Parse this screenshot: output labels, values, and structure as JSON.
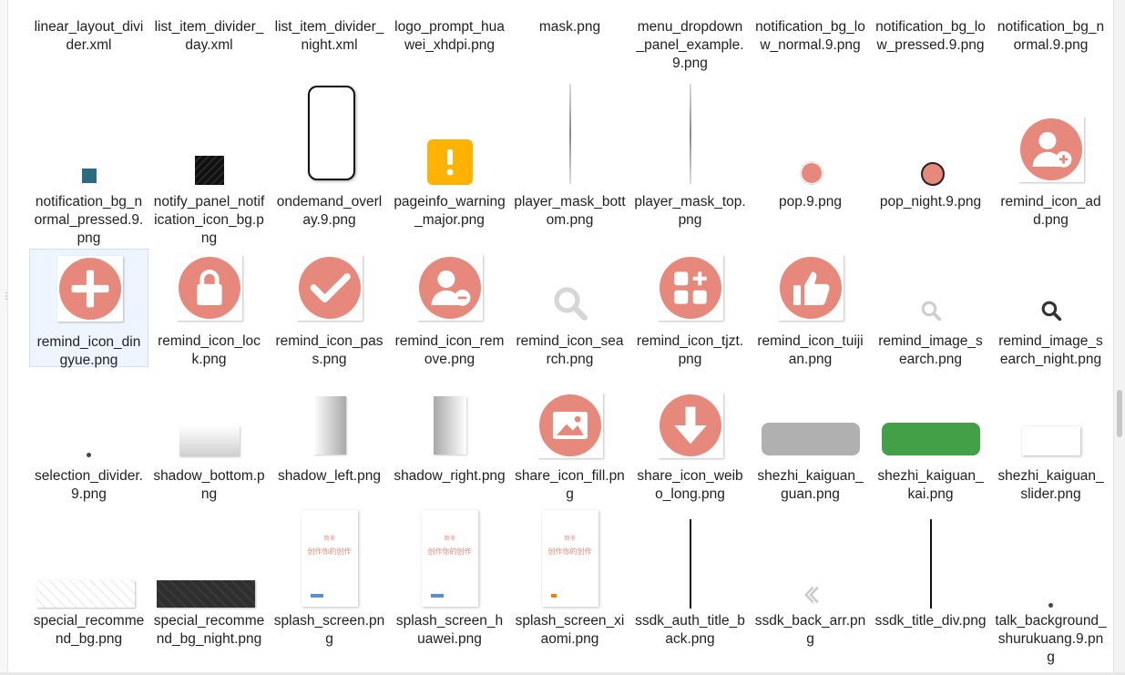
{
  "colors": {
    "accent_icon": "#e6897c",
    "selection_bg": "#eef5ff",
    "teal_square": "#2e6a80",
    "green_switch": "#43a047",
    "gray_switch": "#b0b0b0",
    "warning": "#ffb300"
  },
  "splash": {
    "title_small": "简书",
    "tagline": "创作你的创作"
  },
  "files": [
    {
      "name": "linear_layout_divider.xml",
      "thumb": "topframe"
    },
    {
      "name": "list_item_divider_day.xml",
      "thumb": "topframe"
    },
    {
      "name": "list_item_divider_night.xml",
      "thumb": "topframe"
    },
    {
      "name": "logo_prompt_huawei_xhdpi.png",
      "thumb": "topframe-accent"
    },
    {
      "name": "mask.png",
      "thumb": "dot-top"
    },
    {
      "name": "menu_dropdown_panel_example.9.png",
      "thumb": "topframe"
    },
    {
      "name": "notification_bg_low_normal.9.png",
      "thumb": "topstub-dark"
    },
    {
      "name": "notification_bg_low_pressed.9.png",
      "thumb": "topstub-teal"
    },
    {
      "name": "notification_bg_normal.9.png",
      "thumb": "topstub-dark"
    },
    {
      "name": "notification_bg_normal_pressed.9.png",
      "thumb": "teal-square"
    },
    {
      "name": "notify_panel_notification_icon_bg.png",
      "thumb": "black-square"
    },
    {
      "name": "ondemand_overlay.9.png",
      "thumb": "phone-frame"
    },
    {
      "name": "pageinfo_warning_major.png",
      "thumb": "warning"
    },
    {
      "name": "player_mask_bottom.png",
      "thumb": "vline"
    },
    {
      "name": "player_mask_top.png",
      "thumb": "vline"
    },
    {
      "name": "pop.9.png",
      "thumb": "pop"
    },
    {
      "name": "pop_night.9.png",
      "thumb": "pop-night"
    },
    {
      "name": "remind_icon_add.png",
      "thumb": "circle-user-add"
    },
    {
      "name": "remind_icon_dingyue.png",
      "thumb": "circle-plus",
      "selected": true
    },
    {
      "name": "remind_icon_lock.png",
      "thumb": "circle-lock"
    },
    {
      "name": "remind_icon_pass.png",
      "thumb": "circle-check"
    },
    {
      "name": "remind_icon_remove.png",
      "thumb": "circle-user-remove"
    },
    {
      "name": "remind_icon_search.png",
      "thumb": "search-light"
    },
    {
      "name": "remind_icon_tjzt.png",
      "thumb": "circle-grid"
    },
    {
      "name": "remind_icon_tuijian.png",
      "thumb": "circle-thumb"
    },
    {
      "name": "remind_image_search.png",
      "thumb": "search-small-light"
    },
    {
      "name": "remind_image_search_night.png",
      "thumb": "search-small-dark"
    },
    {
      "name": "selection_divider.9.png",
      "thumb": "tiny-dot"
    },
    {
      "name": "shadow_bottom.png",
      "thumb": "shadow-bottom"
    },
    {
      "name": "shadow_left.png",
      "thumb": "shadow-left"
    },
    {
      "name": "shadow_right.png",
      "thumb": "shadow-right"
    },
    {
      "name": "share_icon_fill.png",
      "thumb": "circle-image"
    },
    {
      "name": "share_icon_weibo_long.png",
      "thumb": "circle-arrow"
    },
    {
      "name": "shezhi_kaiguan_guan.png",
      "thumb": "switch-gray"
    },
    {
      "name": "shezhi_kaiguan_kai.png",
      "thumb": "switch-green"
    },
    {
      "name": "shezhi_kaiguan_slider.png",
      "thumb": "switch-white"
    },
    {
      "name": "special_recommend_bg.png",
      "thumb": "pattern-light"
    },
    {
      "name": "special_recommend_bg_night.png",
      "thumb": "pattern-dark"
    },
    {
      "name": "splash_screen.png",
      "thumb": "splash"
    },
    {
      "name": "splash_screen_huawei.png",
      "thumb": "splash"
    },
    {
      "name": "splash_screen_xiaomi.png",
      "thumb": "splash-xiaomi"
    },
    {
      "name": "ssdk_auth_title_back.png",
      "thumb": "vline-dark"
    },
    {
      "name": "ssdk_back_arr.png",
      "thumb": "back-arrow"
    },
    {
      "name": "ssdk_title_div.png",
      "thumb": "vline-dark"
    },
    {
      "name": "talk_background_shurukuang.9.png",
      "thumb": "tiny-dot"
    }
  ]
}
